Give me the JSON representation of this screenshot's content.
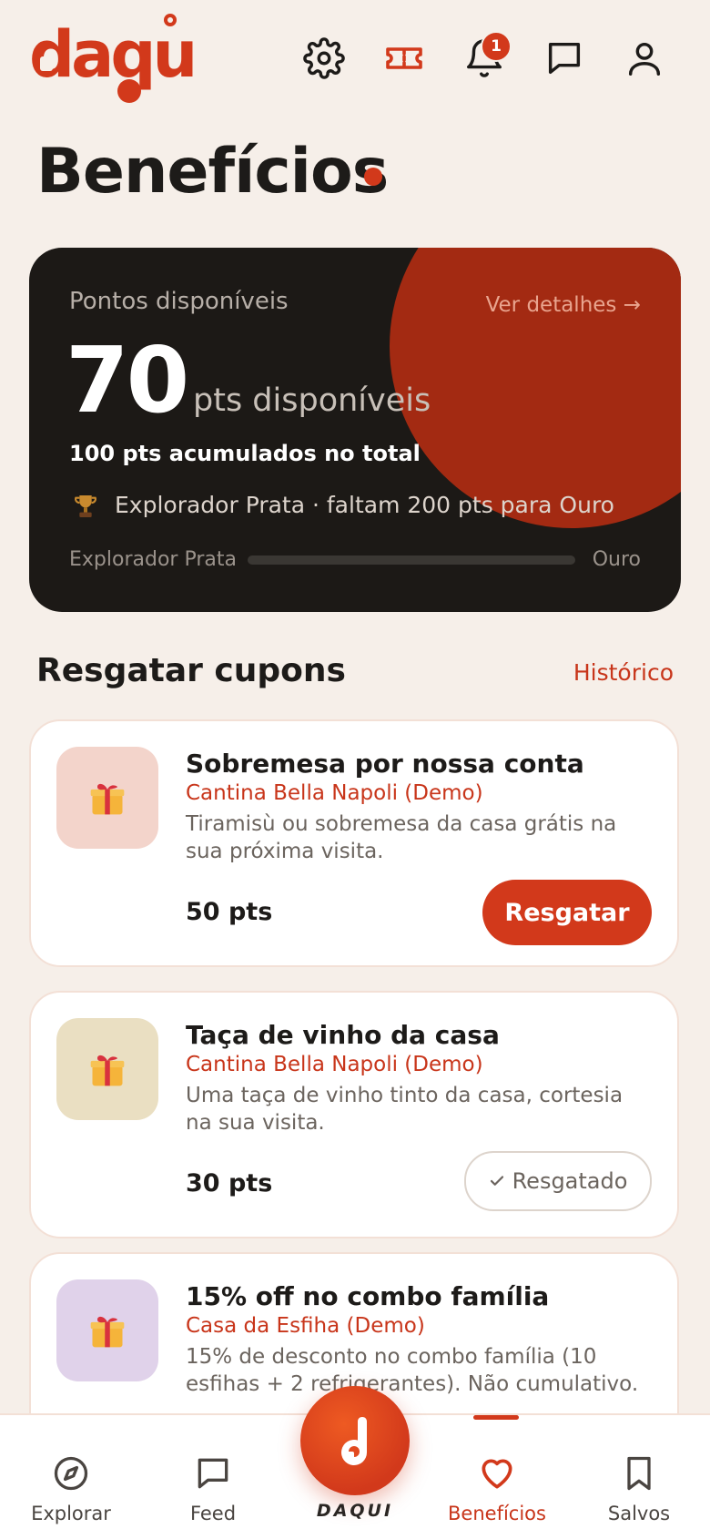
{
  "app": {
    "logo_text": "daqui",
    "brand_color": "#d2391b"
  },
  "header": {
    "icons": [
      "gear-icon",
      "ticket-icon",
      "bell-icon",
      "chat-icon",
      "user-icon"
    ],
    "notification_count": "1"
  },
  "page": {
    "title": "Benefícios"
  },
  "points": {
    "label": "Pontos disponíveis",
    "details_link": "Ver detalhes →",
    "value": "70",
    "unit": "pts disponíveis",
    "total": "100 pts acumulados no total",
    "level_text": "Explorador Prata · faltam 200 pts para Ouro",
    "progress_start": "Explorador Prata",
    "progress_end": "Ouro",
    "progress_fraction": 0
  },
  "coupons_section": {
    "title": "Resgatar cupons",
    "history_link": "Histórico"
  },
  "coupons": [
    {
      "title": "Sobremesa por nossa conta",
      "place": "Cantina Bella Napoli (Demo)",
      "description": "Tiramisù ou sobremesa da casa grátis na sua próxima visita.",
      "points": "50 pts",
      "action": "Resgatar",
      "icon_bg": "#f3d4cb"
    },
    {
      "title": "Taça de vinho da casa",
      "place": "Cantina Bella Napoli (Demo)",
      "description": "Uma taça de vinho tinto da casa, cortesia na sua visita.",
      "points": "30 pts",
      "action": "Resgatado",
      "icon_bg": "#eadfc2"
    },
    {
      "title": "15% off no combo família",
      "place": "Casa da Esfiha (Demo)",
      "description": "15% de desconto no combo família (10 esfihas + 2 refrigerantes). Não cumulativo.",
      "icon_bg": "#e0d2ea"
    }
  ],
  "nav": {
    "items": [
      {
        "label": "Explorar",
        "icon": "compass-icon"
      },
      {
        "label": "Feed",
        "icon": "chat-icon"
      },
      {
        "label": "DAQUI",
        "icon": "daqui-logo-icon"
      },
      {
        "label": "Benefícios",
        "icon": "heart-icon",
        "active": true
      },
      {
        "label": "Salvos",
        "icon": "bookmark-icon"
      }
    ]
  }
}
